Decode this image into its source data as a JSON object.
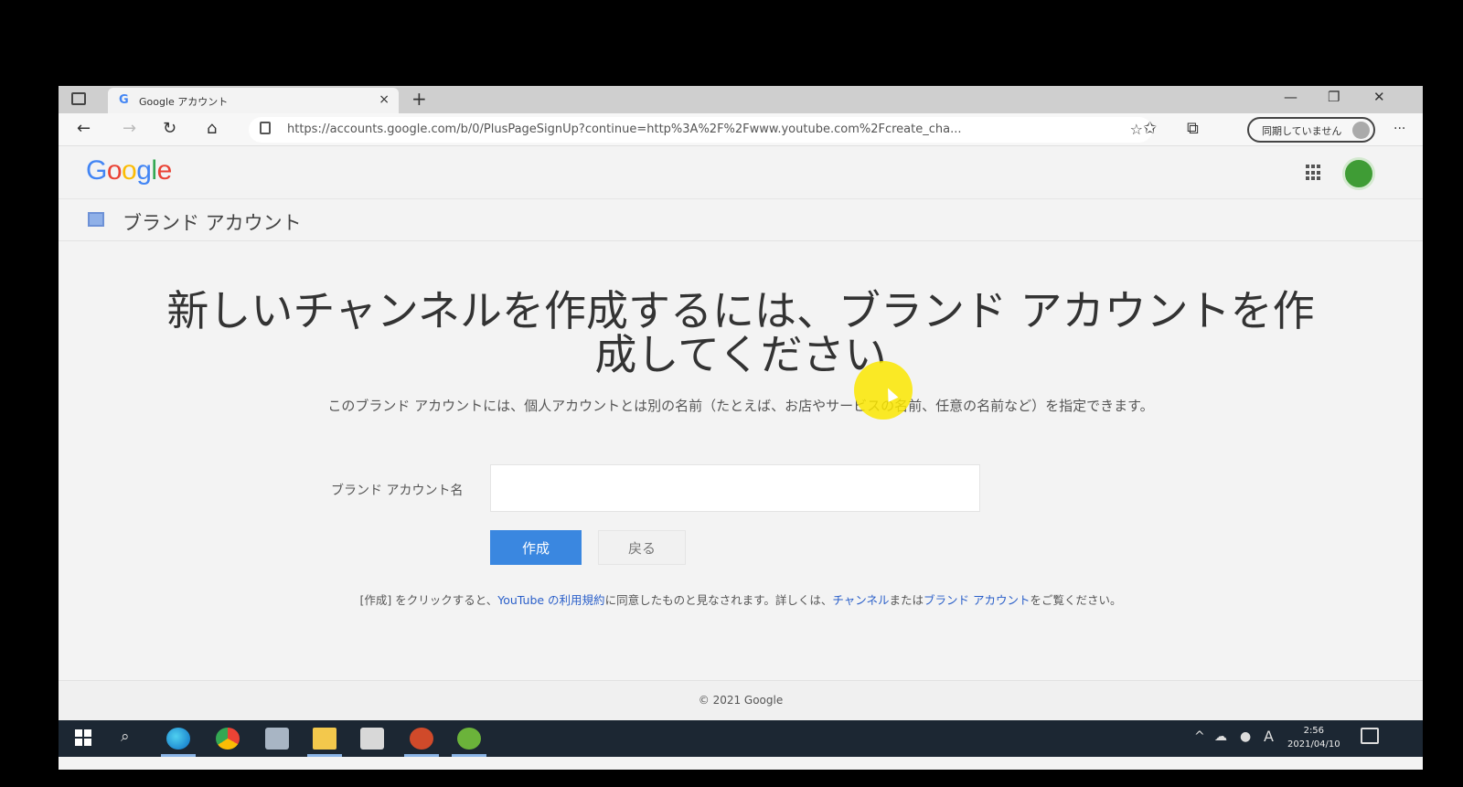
{
  "browser": {
    "tab_title": "Google アカウント",
    "tab_close": "×",
    "new_tab": "+",
    "window_controls": [
      "—",
      "❐",
      "✕"
    ],
    "url": "https://accounts.google.com/b/0/PlusPageSignUp?continue=http%3A%2F%2Fwww.youtube.com%2Fcreate_cha...",
    "sync_label": "同期していません",
    "more": "···"
  },
  "header": {
    "logo": "Google",
    "section_title": "ブランド アカウント"
  },
  "main": {
    "headline_line1": "新しいチャンネルを作成するには、ブランド アカウントを作",
    "headline_line2": "成してください",
    "description": "このブランド アカウントには、個人アカウントとは別の名前（たとえば、お店やサービスの名前、任意の名前など）を指定できます。",
    "name_label": "ブランド アカウント名",
    "name_value": "",
    "create_button": "作成",
    "back_button": "戻る",
    "terms_prefix": "[作成] をクリックすると、",
    "terms_link": "YouTube の利用規約",
    "terms_middle": "に同意したものと見なされます。詳しくは、",
    "channel_link": "チャンネル",
    "or_text": "または",
    "brand_link": "ブランド アカウント",
    "terms_suffix": "をご覧ください。"
  },
  "footer": {
    "copyright": "© 2021 Google"
  },
  "taskbar": {
    "time": "2:56",
    "date": "2021/04/10",
    "ime": "A"
  },
  "colors": {
    "primary_button": "#3a87e0",
    "link": "#2a5fc9",
    "taskbar": "#1c2733"
  }
}
